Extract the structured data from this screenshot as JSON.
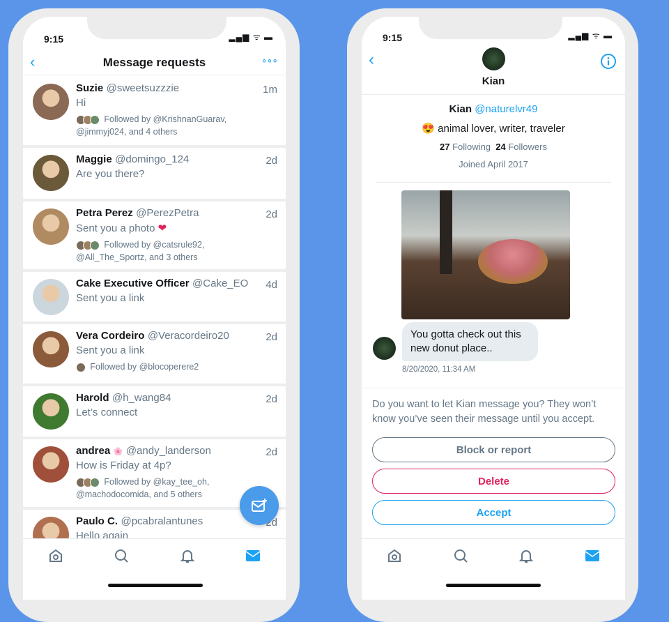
{
  "left": {
    "time": "9:15",
    "title": "Message requests",
    "more_icon": "ellipsis-icon",
    "requests": [
      {
        "name": "Suzie",
        "handle": "@sweetsuzzzie",
        "time": "1m",
        "message": "Hi",
        "followed": "Followed by @KrishnanGuarav,",
        "followed2": "@jimmyj024, and 4 others",
        "color": "#8a6a55"
      },
      {
        "name": "Maggie",
        "handle": "@domingo_124",
        "time": "2d",
        "message": "Are you there?",
        "color": "#6b5a3a"
      },
      {
        "name": "Petra Perez",
        "handle": "@PerezPetra",
        "time": "2d",
        "message": "Sent you a photo",
        "heart": "❤",
        "followed": "Followed by @catsrule92,",
        "followed2": "@All_The_Sportz, and 3 others",
        "color": "#b08a60"
      },
      {
        "name": "Cake Executive Officer",
        "handle": "@Cake_EO",
        "time": "4d",
        "message": "Sent you a link",
        "color": "#ccd6dd"
      },
      {
        "name": "Vera Cordeiro",
        "handle": "@Veracordeiro20",
        "time": "2d",
        "message": "Sent you a link",
        "followed": "Followed by @blocoperere2",
        "color": "#8a5a3a"
      },
      {
        "name": "Harold",
        "handle": "@h_wang84",
        "time": "2d",
        "message": "Let’s connect",
        "color": "#3f7a30"
      },
      {
        "name": "andrea",
        "flower": "🌸",
        "handle": "@andy_landerson",
        "time": "2d",
        "message": "How is Friday at 4p?",
        "followed": "Followed by @kay_tee_oh,",
        "followed2": "@machodocomida, and 5 others",
        "color": "#a0503a"
      },
      {
        "name": "Paulo C.",
        "handle": "@pcabralantunes",
        "time": "2d",
        "message": "Hello again",
        "color": "#b07050"
      }
    ]
  },
  "right": {
    "time": "9:15",
    "header_name": "Kian",
    "profile": {
      "name": "Kian",
      "handle": "@naturelvr49",
      "bio_emoji": "😍",
      "bio": "animal lover, writer, traveler",
      "following_count": "27",
      "following_label": "Following",
      "followers_count": "24",
      "followers_label": "Followers",
      "joined": "Joined April 2017"
    },
    "message": "You gotta check out this new donut place..",
    "timestamp": "8/20/2020, 11:34 AM",
    "prompt": "Do you want to let Kian message you? They won’t know you’ve seen their message until you accept.",
    "buttons": {
      "block": "Block or report",
      "delete": "Delete",
      "accept": "Accept"
    }
  },
  "colors": {
    "background": "#5b95e9",
    "accent": "#1da1f2",
    "delete": "#e0245e"
  }
}
